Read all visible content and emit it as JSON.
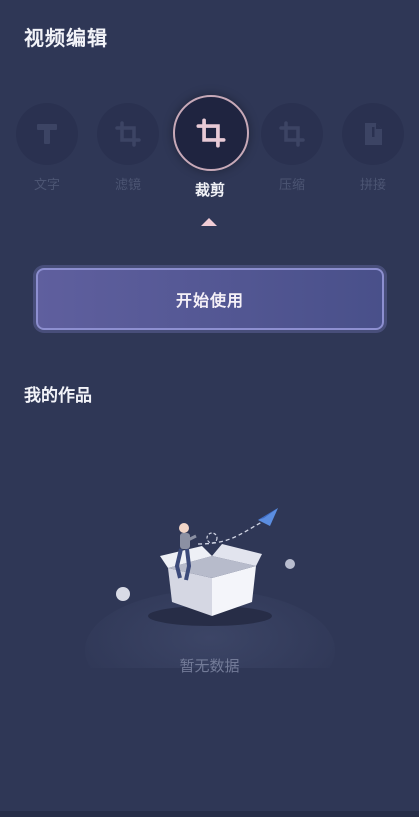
{
  "header": {
    "title": "视频编辑"
  },
  "tools": [
    {
      "label": "文字",
      "icon": "text-icon",
      "active": false
    },
    {
      "label": "滤镜",
      "icon": "crop-icon",
      "active": false
    },
    {
      "label": "裁剪",
      "icon": "crop-icon",
      "active": true
    },
    {
      "label": "压缩",
      "icon": "crop-icon",
      "active": false
    },
    {
      "label": "拼接",
      "icon": "file-icon",
      "active": false
    }
  ],
  "start_button": {
    "label": "开始使用"
  },
  "works": {
    "title": "我的作品",
    "empty_text": "暂无数据"
  },
  "colors": {
    "background": "#2f3756",
    "accent_button": "#5f5f9e",
    "active_ring": "#c7a9b8",
    "caret": "#f1cdd6"
  }
}
